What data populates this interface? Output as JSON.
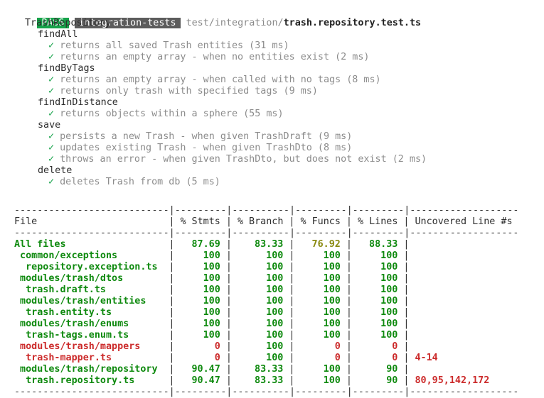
{
  "header": {
    "status_badge": "PASS",
    "project_badge": "integration-tests",
    "path_dir": "test/integration/",
    "path_file": "trash.repository.test.ts"
  },
  "suites": {
    "root": "TrashRepository",
    "groups": [
      {
        "name": "findAll",
        "tests": [
          "returns all saved Trash entities (31 ms)",
          "returns an empty array - when no entities exist (2 ms)"
        ]
      },
      {
        "name": "findByTags",
        "tests": [
          "returns an empty array - when called with no tags (8 ms)",
          "returns only trash with specified tags (9 ms)"
        ]
      },
      {
        "name": "findInDistance",
        "tests": [
          "returns objects within a sphere (55 ms)"
        ]
      },
      {
        "name": "save",
        "tests": [
          "persists a new Trash - when given TrashDraft (9 ms)",
          "updates existing Trash - when given TrashDto (8 ms)",
          "throws an error - when given TrashDto, but does not exist (2 ms)"
        ]
      },
      {
        "name": "delete",
        "tests": [
          "deletes Trash from db (5 ms)"
        ]
      }
    ],
    "check_glyph": "✓"
  },
  "coverage": {
    "separator": "---------------------------|---------|----------|---------|---------|-------------------",
    "headers": [
      "File",
      "% Stmts",
      "% Branch",
      "% Funcs",
      "% Lines",
      "Uncovered Line #s"
    ],
    "colors": {
      "green": "#0f8a0f",
      "yellow": "#8a8a10",
      "red": "#cc2b2b"
    },
    "rows": [
      {
        "file": "All files",
        "indent": 0,
        "stmts": "87.69",
        "branch": "83.33",
        "funcs": "76.92",
        "lines": "88.33",
        "uncovered": "",
        "colors": [
          "g",
          "g",
          "g",
          "y",
          "g",
          "g"
        ]
      },
      {
        "file": "common/exceptions",
        "indent": 1,
        "stmts": "100",
        "branch": "100",
        "funcs": "100",
        "lines": "100",
        "uncovered": "",
        "colors": [
          "g",
          "g",
          "g",
          "g",
          "g",
          "g"
        ]
      },
      {
        "file": "repository.exception.ts",
        "indent": 2,
        "stmts": "100",
        "branch": "100",
        "funcs": "100",
        "lines": "100",
        "uncovered": "",
        "colors": [
          "g",
          "g",
          "g",
          "g",
          "g",
          "g"
        ]
      },
      {
        "file": "modules/trash/dtos",
        "indent": 1,
        "stmts": "100",
        "branch": "100",
        "funcs": "100",
        "lines": "100",
        "uncovered": "",
        "colors": [
          "g",
          "g",
          "g",
          "g",
          "g",
          "g"
        ]
      },
      {
        "file": "trash.draft.ts",
        "indent": 2,
        "stmts": "100",
        "branch": "100",
        "funcs": "100",
        "lines": "100",
        "uncovered": "",
        "colors": [
          "g",
          "g",
          "g",
          "g",
          "g",
          "g"
        ]
      },
      {
        "file": "modules/trash/entities",
        "indent": 1,
        "stmts": "100",
        "branch": "100",
        "funcs": "100",
        "lines": "100",
        "uncovered": "",
        "colors": [
          "g",
          "g",
          "g",
          "g",
          "g",
          "g"
        ]
      },
      {
        "file": "trash.entity.ts",
        "indent": 2,
        "stmts": "100",
        "branch": "100",
        "funcs": "100",
        "lines": "100",
        "uncovered": "",
        "colors": [
          "g",
          "g",
          "g",
          "g",
          "g",
          "g"
        ]
      },
      {
        "file": "modules/trash/enums",
        "indent": 1,
        "stmts": "100",
        "branch": "100",
        "funcs": "100",
        "lines": "100",
        "uncovered": "",
        "colors": [
          "g",
          "g",
          "g",
          "g",
          "g",
          "g"
        ]
      },
      {
        "file": "trash-tags.enum.ts",
        "indent": 2,
        "stmts": "100",
        "branch": "100",
        "funcs": "100",
        "lines": "100",
        "uncovered": "",
        "colors": [
          "g",
          "g",
          "g",
          "g",
          "g",
          "g"
        ]
      },
      {
        "file": "modules/trash/mappers",
        "indent": 1,
        "stmts": "0",
        "branch": "100",
        "funcs": "0",
        "lines": "0",
        "uncovered": "",
        "colors": [
          "r",
          "r",
          "g",
          "r",
          "r",
          "r"
        ]
      },
      {
        "file": "trash-mapper.ts",
        "indent": 2,
        "stmts": "0",
        "branch": "100",
        "funcs": "0",
        "lines": "0",
        "uncovered": "4-14",
        "colors": [
          "r",
          "r",
          "g",
          "r",
          "r",
          "r"
        ]
      },
      {
        "file": "modules/trash/repository",
        "indent": 1,
        "stmts": "90.47",
        "branch": "83.33",
        "funcs": "100",
        "lines": "90",
        "uncovered": "",
        "colors": [
          "g",
          "g",
          "g",
          "g",
          "g",
          "r"
        ]
      },
      {
        "file": "trash.repository.ts",
        "indent": 2,
        "stmts": "90.47",
        "branch": "83.33",
        "funcs": "100",
        "lines": "90",
        "uncovered": "80,95,142,172",
        "colors": [
          "g",
          "g",
          "g",
          "g",
          "g",
          "r"
        ]
      }
    ]
  }
}
